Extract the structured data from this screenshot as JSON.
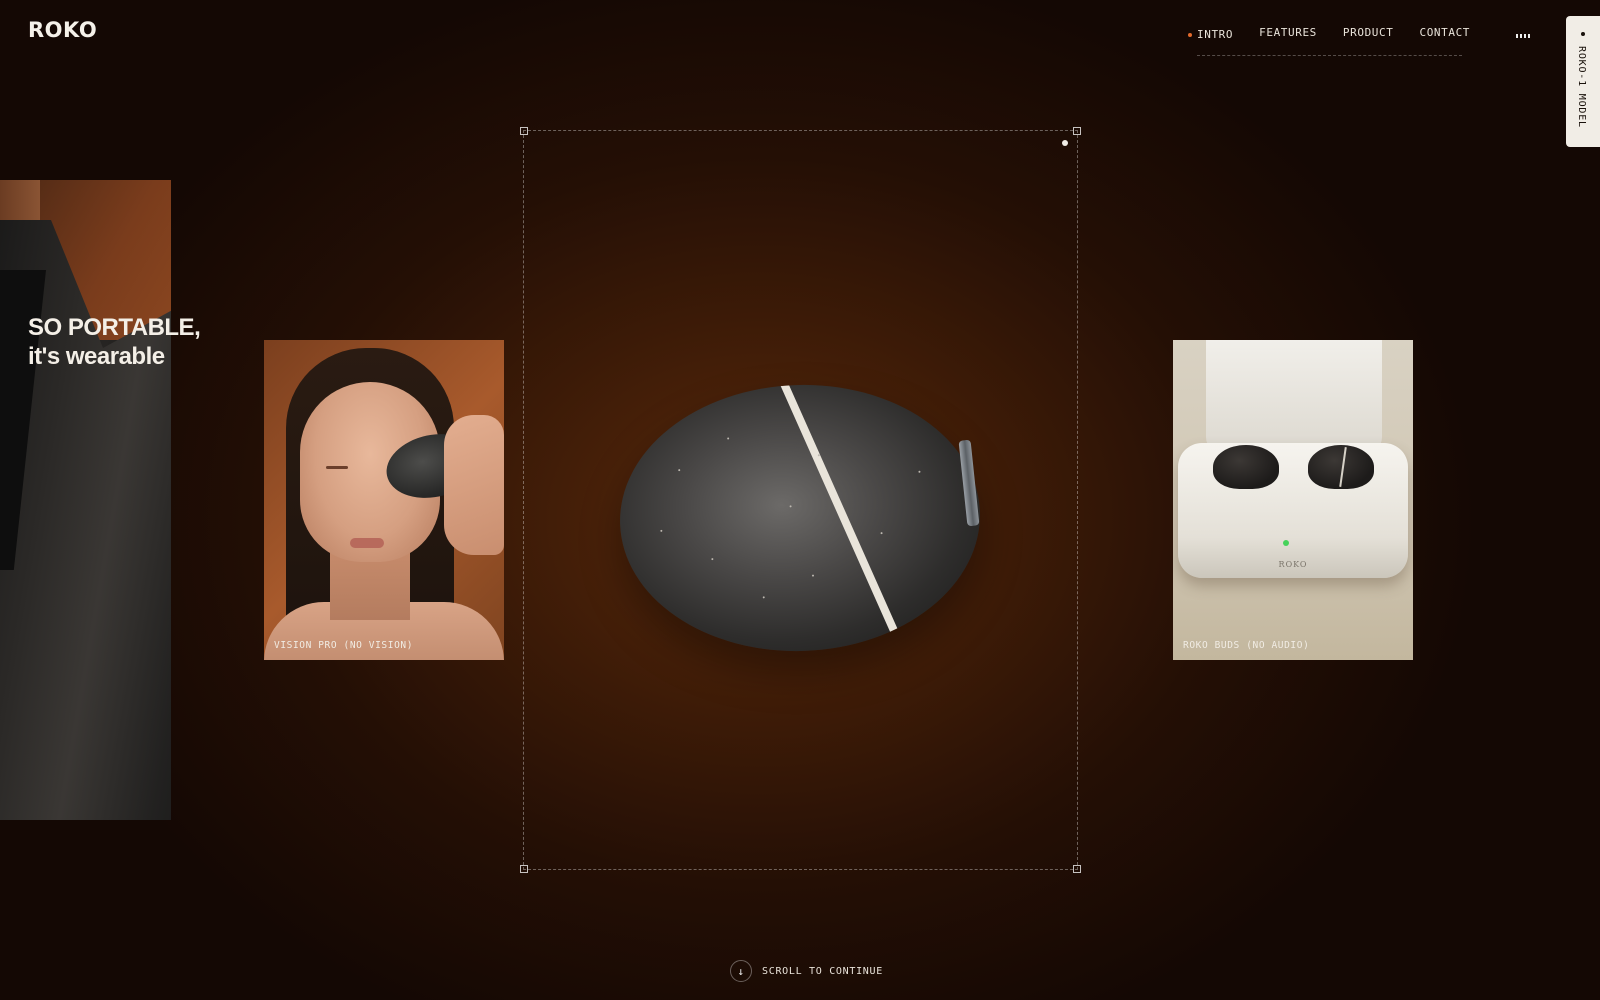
{
  "brand": {
    "logo": "ROKO"
  },
  "nav": {
    "items": [
      {
        "label": "INTRO",
        "active": true
      },
      {
        "label": "FEATURES",
        "active": false
      },
      {
        "label": "PRODUCT",
        "active": false
      },
      {
        "label": "CONTACT",
        "active": false
      }
    ],
    "menu_icon": "menu-dots-icon",
    "active_color": "#e26a2c"
  },
  "side_tab": {
    "label": "ROKO-1 MODEL"
  },
  "hero": {
    "headline_line1": "SO PORTABLE,",
    "headline_line2": "it's wearable"
  },
  "cards": {
    "left": {
      "caption": "VISION PRO (NO VISION)"
    },
    "right": {
      "caption": "ROKO BUDS (NO AUDIO)",
      "brand_mark": "ROKO"
    }
  },
  "scroll": {
    "label": "SCROLL TO CONTINUE",
    "icon": "arrow-down-icon"
  },
  "colors": {
    "background": "#240f05",
    "text": "#f2ede6",
    "led": "#46d25a"
  }
}
